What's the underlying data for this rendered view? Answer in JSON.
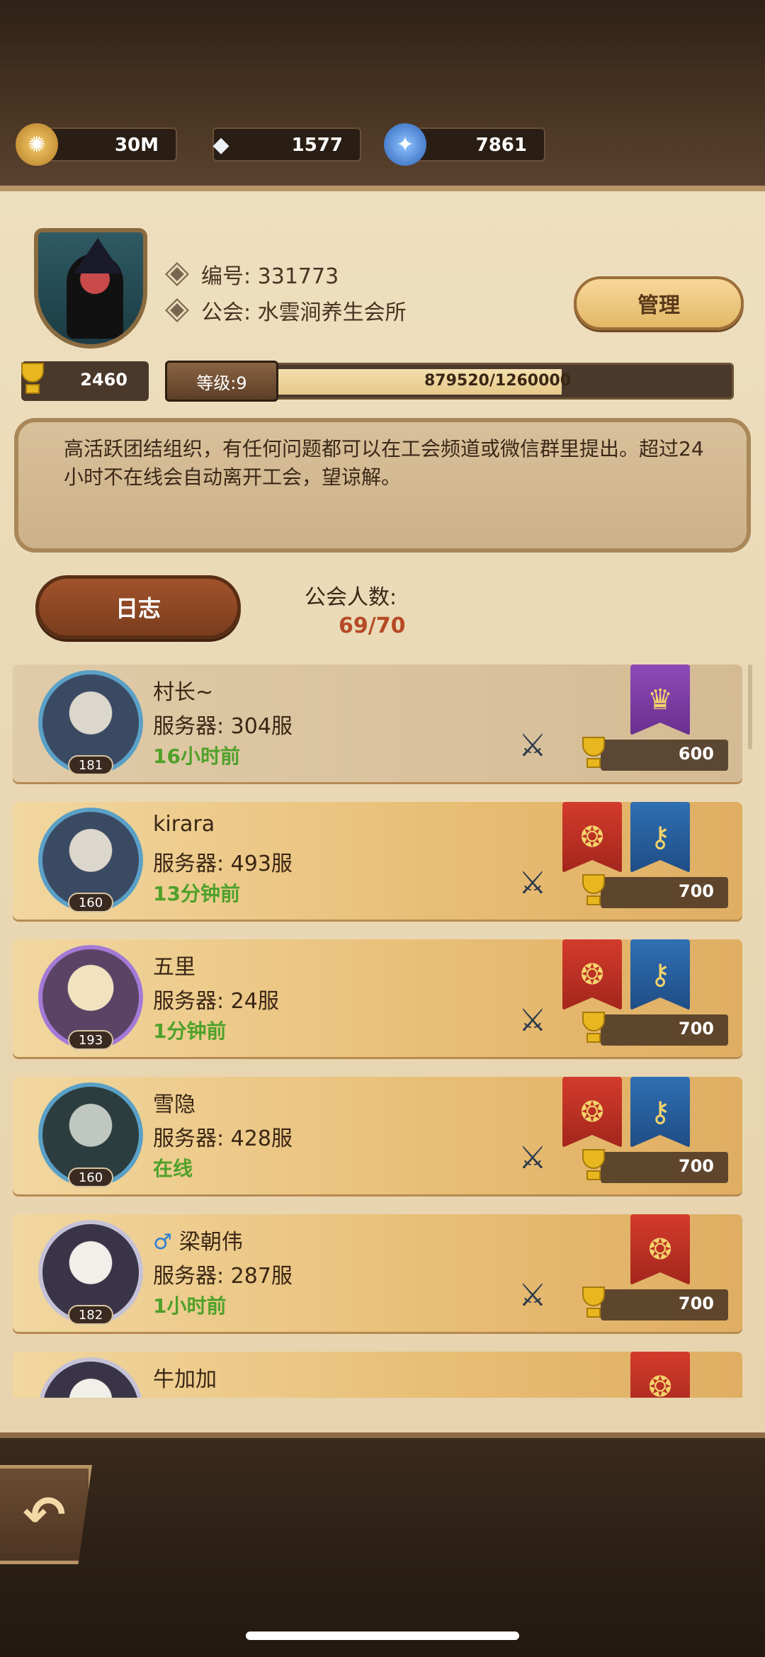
{
  "resources": [
    {
      "icon": "gold-coin-icon",
      "value": "30M",
      "color": "#d9a441"
    },
    {
      "icon": "diamond-icon",
      "value": "1577",
      "color": "#e9ecf2"
    },
    {
      "icon": "potion-icon",
      "value": "7861",
      "color": "#4a8fe0"
    }
  ],
  "guild": {
    "id_label": "编号: 331773",
    "name_label": "公会: 水雲涧养生会所",
    "manage_label": "管理",
    "trophies": "2460",
    "level_label": "等级:9",
    "exp_text": "879520/1260000",
    "exp_fraction": 0.698,
    "notice": "高活跃团结组织，有任何问题都可以在工会频道或微信群里提出。超过24小时不在线会自动离开工会，望谅解。",
    "log_label": "日志",
    "members_label": "公会人数:",
    "members_count": "69/70"
  },
  "members": [
    {
      "name": "村长~",
      "server": "服务器: 304服",
      "time": "16小时前",
      "level": "181",
      "trophies": "600",
      "banners": [
        "purple"
      ]
    },
    {
      "name": "kirara",
      "server": "服务器: 493服",
      "time": "13分钟前",
      "level": "160",
      "trophies": "700",
      "banners": [
        "red",
        "blue"
      ]
    },
    {
      "name": "五里",
      "server": "服务器: 24服",
      "time": "1分钟前",
      "level": "193",
      "trophies": "700",
      "banners": [
        "red",
        "blue"
      ]
    },
    {
      "name": "雪隐",
      "server": "服务器: 428服",
      "time": "在线",
      "level": "160",
      "trophies": "700",
      "banners": [
        "red",
        "blue"
      ]
    },
    {
      "name": "梁朝伟",
      "server": "服务器: 287服",
      "time": "1小时前",
      "level": "182",
      "trophies": "700",
      "banners": [
        "red"
      ]
    },
    {
      "name": "牛加加",
      "server": "",
      "time": "",
      "level": "",
      "trophies": "",
      "banners": [
        "red"
      ]
    }
  ]
}
